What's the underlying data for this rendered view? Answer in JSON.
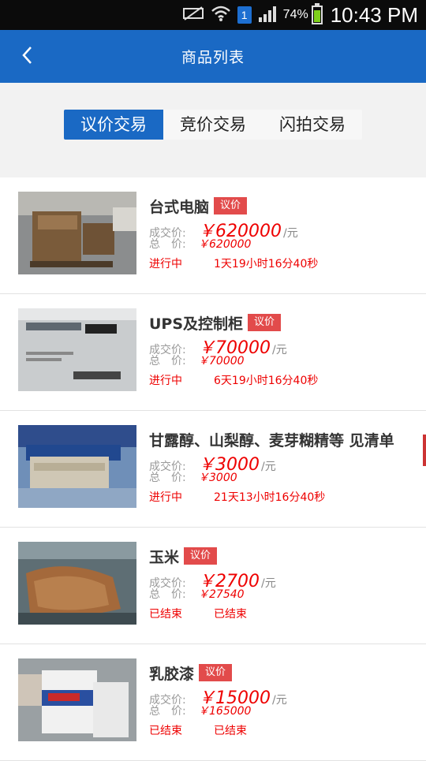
{
  "statusbar": {
    "sim_badge": "1",
    "battery_text": "74%",
    "battery_level": 0.74,
    "time": "10:43 PM"
  },
  "header": {
    "title": "商品列表"
  },
  "tabs": [
    {
      "label": "议价交易",
      "active": true
    },
    {
      "label": "竞价交易",
      "active": false
    },
    {
      "label": "闪拍交易",
      "active": false
    }
  ],
  "labels": {
    "deal_price": "成交价:",
    "total": "总　价:",
    "yuan_unit": "/元"
  },
  "items": [
    {
      "name": "台式电脑",
      "tag": "议价",
      "deal_price": "￥620000",
      "total": "￥620000",
      "status": "进行中",
      "time_left": "1天19小时16分40秒"
    },
    {
      "name": "UPS及控制柜",
      "tag": "议价",
      "deal_price": "￥70000",
      "total": "￥70000",
      "status": "进行中",
      "time_left": "6天19小时16分40秒"
    },
    {
      "name": "甘露醇、山梨醇、麦芽糊精等 见清单",
      "tag": "",
      "deal_price": "￥3000",
      "total": "￥3000",
      "status": "进行中",
      "time_left": "21天13小时16分40秒"
    },
    {
      "name": "玉米",
      "tag": "议价",
      "deal_price": "￥2700",
      "total": "￥27540",
      "status": "已结束",
      "time_left": "已结束"
    },
    {
      "name": "乳胶漆",
      "tag": "议价",
      "deal_price": "￥15000",
      "total": "￥165000",
      "status": "已结束",
      "time_left": "已结束"
    }
  ]
}
